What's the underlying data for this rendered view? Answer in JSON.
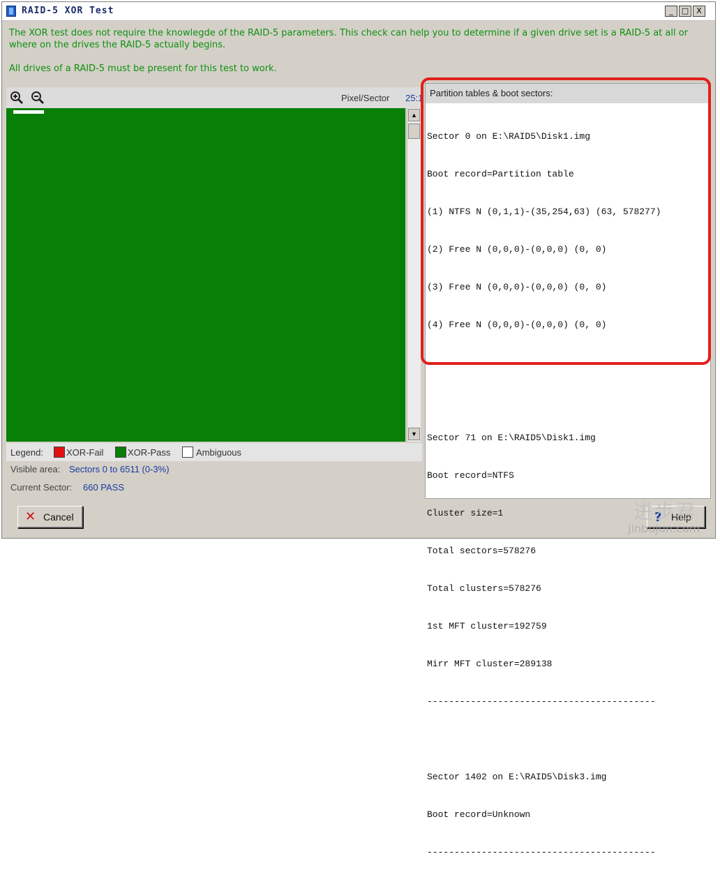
{
  "window": {
    "title": "RAID-5 XOR Test",
    "controls": {
      "minimize": "_",
      "maximize": "□",
      "close": "X"
    }
  },
  "intro": {
    "line1": "The XOR test does not require the knowlegde of the RAID-5 parameters. This check can help you to determine if a given drive set is a RAID-5 at all or where on the drives the RAID-5 actually begins.",
    "line2": "All drives of a RAID-5 must be present for this test to work."
  },
  "toolbar": {
    "zoom_in_icon": "zoom-in-icon",
    "zoom_out_icon": "zoom-out-icon",
    "pixel_label": "Pixel/Sector",
    "pixel_value": "25:1"
  },
  "legend": {
    "label": "Legend:",
    "items": [
      {
        "label": "XOR-Fail",
        "color": "#e01010"
      },
      {
        "label": "XOR-Pass",
        "color": "#088008"
      },
      {
        "label": "Ambiguous",
        "color": "#ffffff"
      }
    ]
  },
  "visible_area": {
    "label": "Visible area:",
    "value": "Sectors 0 to 6511 (0-3%)"
  },
  "current_sector": {
    "label": "Current Sector:",
    "value": "660 PASS"
  },
  "side_panel": {
    "header": "Partition tables & boot sectors:",
    "lines": [
      "Sector 0 on E:\\RAID5\\Disk1.img",
      "Boot record=Partition table",
      "(1) NTFS N (0,1,1)-(35,254,63) (63, 578277)",
      "(2) Free N (0,0,0)-(0,0,0) (0, 0)",
      "(3) Free N (0,0,0)-(0,0,0) (0, 0)",
      "(4) Free N (0,0,0)-(0,0,0) (0, 0)",
      "------------------------------------------",
      "",
      "Sector 71 on E:\\RAID5\\Disk1.img",
      "Boot record=NTFS",
      "Cluster size=1",
      "Total sectors=578276",
      "Total clusters=578276",
      "1st MFT cluster=192759",
      "Mirr MFT cluster=289138",
      "------------------------------------------",
      "",
      "Sector 1402 on E:\\RAID5\\Disk3.img",
      "Boot record=Unknown",
      "------------------------------------------"
    ]
  },
  "buttons": {
    "cancel": "Cancel",
    "help": "Help"
  },
  "watermark": {
    "cn": "进步君",
    "en": "jinbujun.com"
  },
  "colors": {
    "accent_text": "#109010",
    "map_fill": "#088008",
    "highlight": "#e0201a",
    "value_text": "#1a3aa0"
  }
}
